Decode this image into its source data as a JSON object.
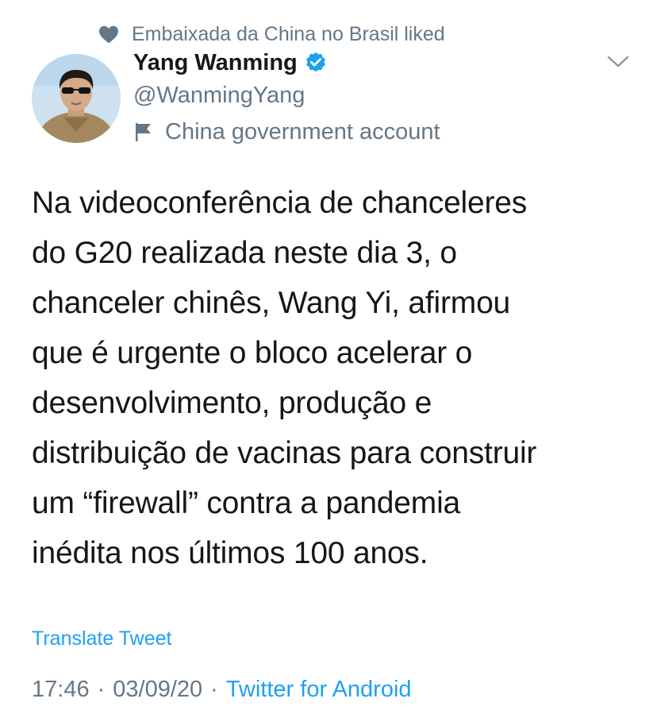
{
  "social_context": {
    "icon": "heart-icon",
    "text": "Embaixada da China no Brasil liked"
  },
  "author": {
    "name": "Yang Wanming",
    "handle": "@WanmingYang",
    "verified_icon": "verified-badge-icon",
    "label_icon": "flag-icon",
    "label": "China government account"
  },
  "tweet": {
    "text": "Na videoconferência de chanceleres\ndo G20 realizada neste dia 3, o\nchanceler chinês, Wang Yi, afirmou\nque é urgente o bloco acelerar o\ndesenvolvimento, produção e\ndistribuição de vacinas para construir\num “firewall” contra a pandemia\ninédita nos últimos 100 anos.",
    "translate_label": "Translate Tweet"
  },
  "meta": {
    "time": "17:46",
    "date": "03/09/20",
    "separator": "·",
    "source": "Twitter for Android"
  },
  "colors": {
    "text_primary": "#14171a",
    "text_secondary": "#657786",
    "accent": "#1da1f2"
  }
}
